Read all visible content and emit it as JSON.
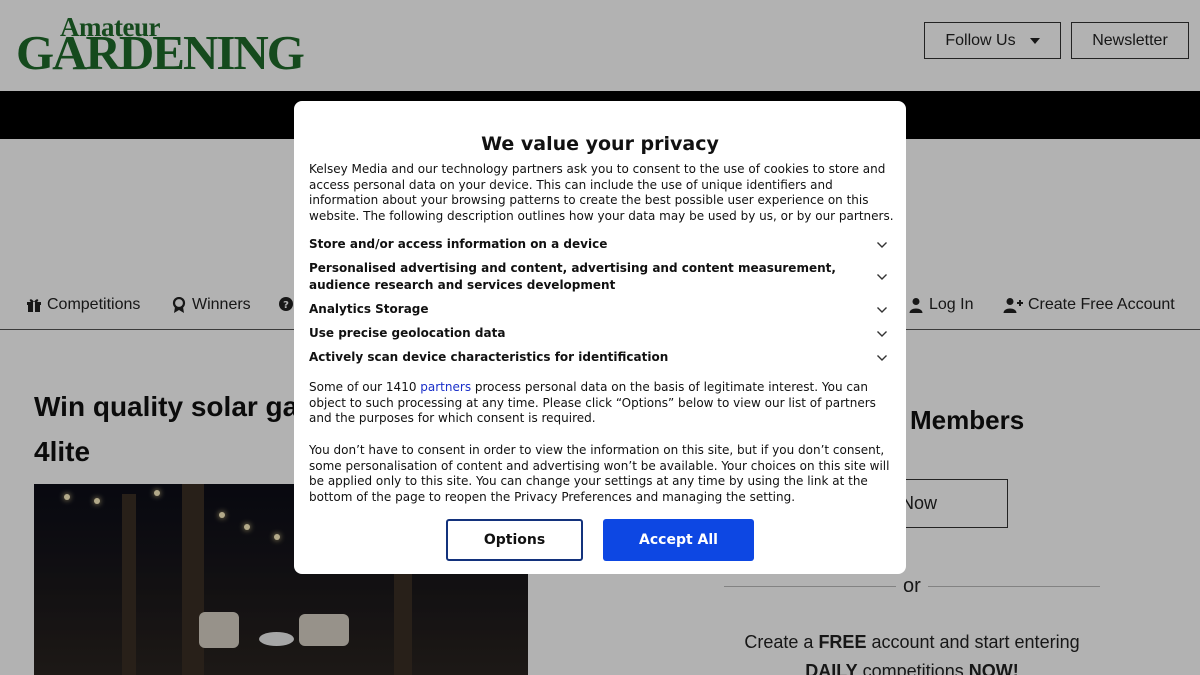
{
  "header": {
    "logo_top": "Amateur",
    "logo_bottom": "GARDENING",
    "follow_label": "Follow Us",
    "newsletter_label": "Newsletter"
  },
  "nav": {
    "competitions": "Competitions",
    "winners": "Winners",
    "login": "Log In",
    "create_account": "Create Free Account"
  },
  "article": {
    "title": "Win quality solar ga",
    "title_line2": "4lite"
  },
  "sidebar": {
    "members": "Members",
    "join": "n Now",
    "or": "or",
    "create_line1_pre": "Create a ",
    "create_line1_bold": "FREE",
    "create_line1_post": " account and start entering",
    "create_line2_bold1": "DAILY",
    "create_line2_mid": " competitions ",
    "create_line2_bold2": "NOW!"
  },
  "consent": {
    "title": "We value your privacy",
    "intro": "Kelsey Media and our technology partners ask you to consent to the use of cookies to store and access personal data on your device. This can include the use of unique identifiers and information about your browsing patterns to create the best possible user experience on this website. The following description outlines how your data may be used by us, or by our partners.",
    "purposes": [
      "Store and/or access information on a device",
      "Personalised advertising and content, advertising and content measurement, audience research and services development",
      "Analytics Storage",
      "Use precise geolocation data",
      "Actively scan device characteristics for identification"
    ],
    "p2_pre": "Some of our 1410 ",
    "p2_link": "partners",
    "p2_post": " process personal data on the basis of legitimate interest. You can object to such processing at any time. Please click “Options” below to view our list of partners and the purposes for which consent is required.",
    "p3": "You don’t have to consent in order to view the information on this site, but if you don’t consent, some personalisation of content and advertising won’t be available. Your choices on this site will be applied only to this site. You can change your settings at any time by using the link at the bottom of the page to reopen the Privacy Preferences and managing the setting.",
    "options_label": "Options",
    "accept_label": "Accept All"
  },
  "icons": {
    "competitions": "gift-icon",
    "winners": "award-icon",
    "faq": "question-icon",
    "login": "user-icon",
    "create": "user-plus-icon",
    "follow": "caret-down-icon",
    "purpose": "chevron-down-icon"
  },
  "colors": {
    "brand_green": "#1f6b2a",
    "accept_blue": "#0d47e3",
    "options_border": "#13327c",
    "link_blue": "#1a2fc9"
  }
}
